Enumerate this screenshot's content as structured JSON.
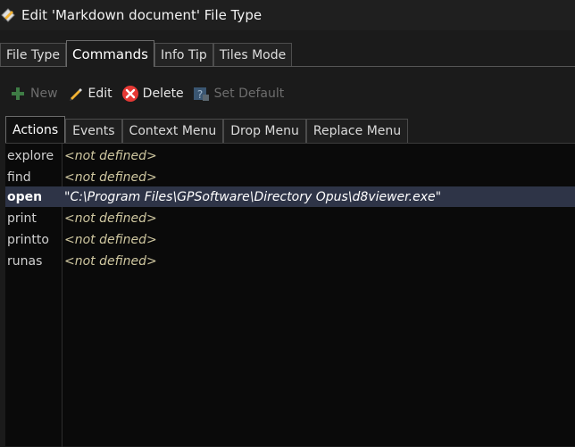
{
  "window": {
    "title": "Edit 'Markdown document' File Type"
  },
  "outer_tabs": [
    {
      "label": "File Type"
    },
    {
      "label": "Commands"
    },
    {
      "label": "Info Tip"
    },
    {
      "label": "Tiles Mode"
    }
  ],
  "toolbar": {
    "new_label": "New",
    "edit_label": "Edit",
    "delete_label": "Delete",
    "set_default_label": "Set Default"
  },
  "inner_tabs": [
    {
      "label": "Actions"
    },
    {
      "label": "Events"
    },
    {
      "label": "Context Menu"
    },
    {
      "label": "Drop Menu"
    },
    {
      "label": "Replace Menu"
    }
  ],
  "actions": [
    {
      "name": "explore",
      "value": "<not defined>"
    },
    {
      "name": "find",
      "value": "<not defined>"
    },
    {
      "name": "open",
      "value": "\"C:\\Program Files\\GPSoftware\\Directory Opus\\d8viewer.exe\""
    },
    {
      "name": "print",
      "value": "<not defined>"
    },
    {
      "name": "printto",
      "value": "<not defined>"
    },
    {
      "name": "runas",
      "value": "<not defined>"
    }
  ],
  "colors": {
    "selected_row": "#2e3447",
    "undefined_text": "#cfc7a0",
    "new_icon": "#4caf50",
    "delete_icon": "#e53935"
  },
  "icons": {
    "app": "filetype-edit-icon",
    "new": "plus-icon",
    "edit": "pencil-icon",
    "delete": "x-circle-icon",
    "set_default": "help-default-icon"
  }
}
